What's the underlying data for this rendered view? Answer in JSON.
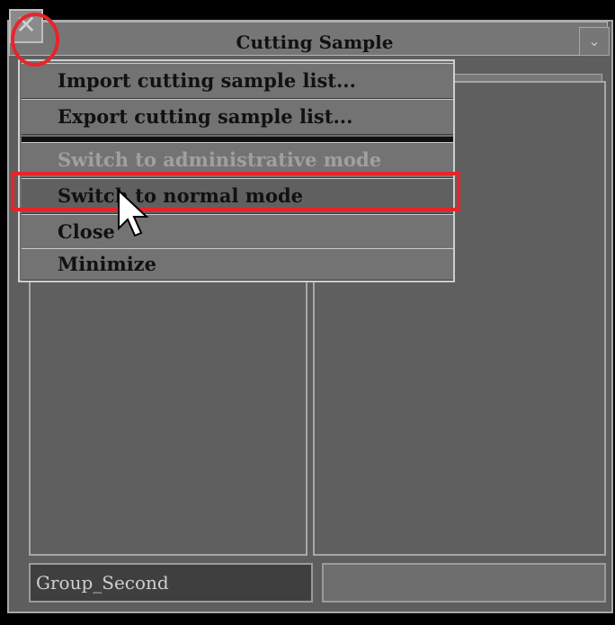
{
  "window": {
    "title": "Cutting Sample",
    "close_glyph": "✕",
    "menu_glyph": "⌄"
  },
  "menu": {
    "items": [
      {
        "label": "Import cutting sample list...",
        "enabled": true
      },
      {
        "label": "Export cutting sample list...",
        "enabled": true
      },
      {
        "label": "Switch to administrative mode",
        "enabled": false
      },
      {
        "label": "Switch to normal mode",
        "enabled": true,
        "hovered": true
      },
      {
        "label": "Close",
        "enabled": true
      },
      {
        "label": "Minimize",
        "enabled": true
      }
    ]
  },
  "footer": {
    "left_field_value": "Group_Second",
    "right_field_value": ""
  },
  "annotations": {
    "color": "#e8242a"
  },
  "icons": {
    "close": "close-icon",
    "chevron": "chevron-down-icon",
    "cursor": "mouse-pointer-icon"
  }
}
